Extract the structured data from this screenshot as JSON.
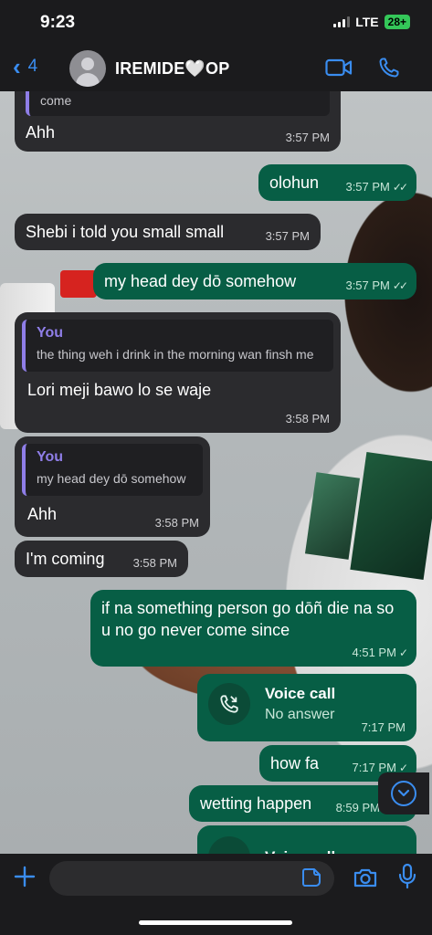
{
  "status_bar": {
    "time": "9:23",
    "network": "LTE",
    "battery": "28+"
  },
  "header": {
    "back_count": "4",
    "contact_name": "IREMIDE🤍OP",
    "icons": [
      "chevron-left-icon",
      "avatar",
      "video-call-icon",
      "phone-icon"
    ],
    "accent_color": "#3a8df0"
  },
  "messages": [
    {
      "dir": "in",
      "quote_tail": "come",
      "text": "Ahh",
      "time": "3:57 PM"
    },
    {
      "dir": "out",
      "text": "olohun",
      "time": "3:57 PM",
      "status": "read"
    },
    {
      "dir": "in",
      "text": "Shebi i told you small small",
      "time": "3:57 PM"
    },
    {
      "dir": "out",
      "text": "my head dey dō somehow",
      "time": "3:57 PM",
      "status": "read"
    },
    {
      "dir": "in",
      "quote_name": "You",
      "quote_text": "the thing weh i drink in the morning wan finsh me",
      "text": "Lori meji bawo lo se waje",
      "time": "3:58 PM"
    },
    {
      "dir": "in",
      "quote_name": "You",
      "quote_text": "my head dey dō somehow",
      "text": "Ahh",
      "time": "3:58 PM"
    },
    {
      "dir": "in",
      "text": "I'm coming",
      "time": "3:58 PM"
    },
    {
      "dir": "out",
      "text": "if na something person go dōñ die na so u no go never come since",
      "time": "4:51 PM",
      "status": "sent"
    },
    {
      "dir": "out",
      "type": "call",
      "call_title": "Voice call",
      "call_sub": "No answer",
      "time": "7:17 PM"
    },
    {
      "dir": "out",
      "text": "how fa",
      "time": "7:17 PM",
      "status": "sent"
    },
    {
      "dir": "out",
      "text": "wetting happen",
      "time": "8:59 PM"
    },
    {
      "dir": "out",
      "type": "call",
      "call_title": "Voice call"
    }
  ],
  "composer": {
    "placeholder": ""
  },
  "colors": {
    "incoming_bubble": "#2b2b2e",
    "outgoing_bubble": "#075e45",
    "quote_bar": "#8f7ee8"
  }
}
